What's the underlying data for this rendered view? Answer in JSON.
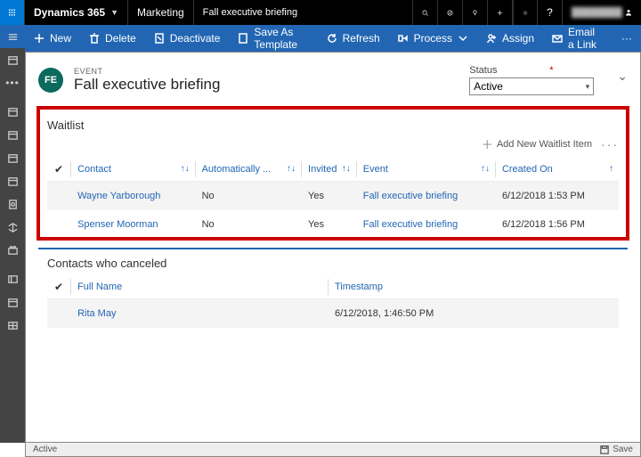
{
  "topbar": {
    "brand": "Dynamics 365",
    "module": "Marketing",
    "crumb": "Fall executive briefing"
  },
  "cmd": {
    "new": "New",
    "delete": "Delete",
    "deactivate": "Deactivate",
    "saveas": "Save As Template",
    "refresh": "Refresh",
    "process": "Process",
    "assign": "Assign",
    "email": "Email a Link"
  },
  "header": {
    "kicker": "EVENT",
    "title": "Fall executive briefing",
    "badge": "FE",
    "status_label": "Status",
    "status_value": "Active"
  },
  "waitlist": {
    "title": "Waitlist",
    "add_label": "Add New Waitlist Item",
    "cols": {
      "contact": "Contact",
      "auto": "Automatically ...",
      "invited": "Invited",
      "event": "Event",
      "created": "Created On"
    },
    "rows": [
      {
        "contact": "Wayne Yarborough",
        "auto": "No",
        "invited": "Yes",
        "event": "Fall executive briefing",
        "created": "6/12/2018 1:53 PM"
      },
      {
        "contact": "Spenser Moorman",
        "auto": "No",
        "invited": "Yes",
        "event": "Fall executive briefing",
        "created": "6/12/2018 1:56 PM"
      }
    ]
  },
  "canceled": {
    "title": "Contacts who canceled",
    "cols": {
      "name": "Full Name",
      "ts": "Timestamp"
    },
    "rows": [
      {
        "name": "Rita May",
        "ts": "6/12/2018, 1:46:50 PM"
      }
    ]
  },
  "footer": {
    "status": "Active",
    "save": "Save"
  }
}
